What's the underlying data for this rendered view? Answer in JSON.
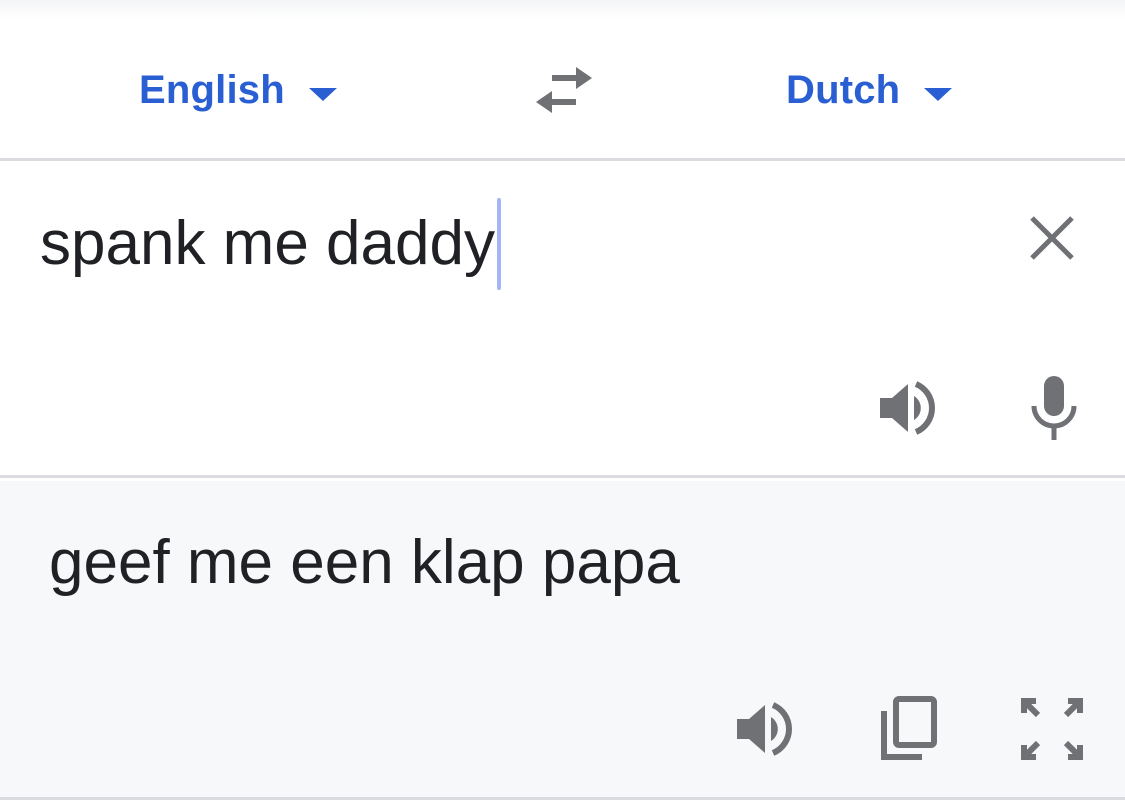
{
  "languages": {
    "source": "English",
    "target": "Dutch"
  },
  "input": {
    "text": "spank me daddy"
  },
  "output": {
    "text": "geef me een klap papa"
  },
  "icons": {
    "swap": "swap-arrows-icon",
    "clear": "close-icon",
    "speak_source": "speaker-icon",
    "mic": "microphone-icon",
    "speak_result": "speaker-icon",
    "copy": "copy-icon",
    "fullscreen": "fullscreen-icon"
  },
  "colors": {
    "accent": "#2a5fd3",
    "icon": "#6f7174",
    "text": "#202124",
    "cursor": "#a4b4f5",
    "result_background": "#f7f8fa",
    "divider": "#dadce0"
  }
}
